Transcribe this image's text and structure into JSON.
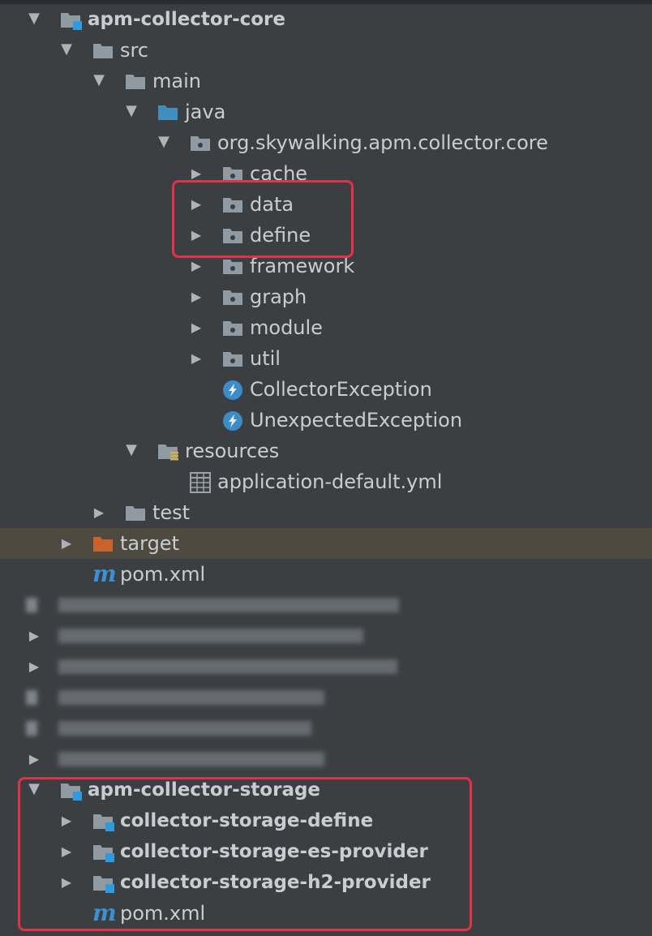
{
  "tree": {
    "module_core": "apm-collector-core",
    "src": "src",
    "main": "main",
    "java": "java",
    "package": "org.skywalking.apm.collector.core",
    "pkg_cache": "cache",
    "pkg_data": "data",
    "pkg_define": "define",
    "pkg_framework": "framework",
    "pkg_graph": "graph",
    "pkg_module": "module",
    "pkg_util": "util",
    "class_collector_exception": "CollectorException",
    "class_unexpected_exception": "UnexpectedException",
    "resources": "resources",
    "file_application_default": "application-default.yml",
    "test": "test",
    "target": "target",
    "pom_core": "pom.xml",
    "module_storage": "apm-collector-storage",
    "storage_define": "collector-storage-define",
    "storage_es_provider": "collector-storage-es-provider",
    "storage_h2_provider": "collector-storage-h2-provider",
    "pom_storage": "pom.xml"
  },
  "icons": {
    "maven_file": "m"
  },
  "colors": {
    "background": "#3c3f41",
    "text": "#c9cdd1",
    "folder": "#8f9aa3",
    "java_folder": "#3f8ec0",
    "target_folder": "#c9622b",
    "module_square": "#2f9ae0",
    "exception_icon": "#3c8cc8",
    "highlight": "#e0334a",
    "selected_row": "#4e4a3f"
  }
}
